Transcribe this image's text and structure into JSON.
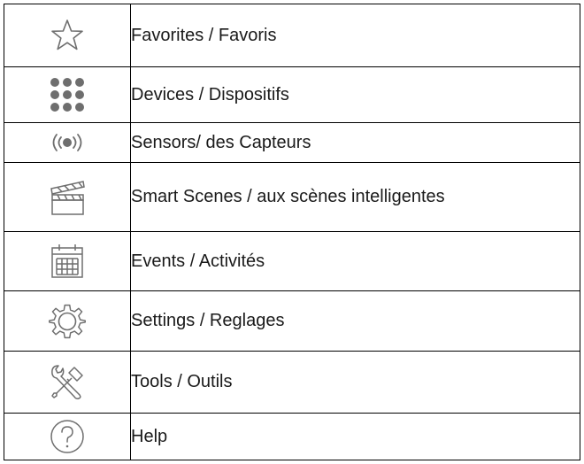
{
  "menu": {
    "items": [
      {
        "icon": "star-icon",
        "label": "Favorites / Favoris"
      },
      {
        "icon": "grid-dots-icon",
        "label": "Devices / Dispositifs"
      },
      {
        "icon": "sensor-broadcast-icon",
        "label": "Sensors/ des Capteurs"
      },
      {
        "icon": "clapperboard-icon",
        "label": "Smart Scenes / aux scènes intelligentes"
      },
      {
        "icon": "calendar-icon",
        "label": "Events / Activités"
      },
      {
        "icon": "gear-icon",
        "label": "Settings / Reglages"
      },
      {
        "icon": "tools-icon",
        "label": "Tools / Outils"
      },
      {
        "icon": "help-question-icon",
        "label": "Help"
      }
    ]
  },
  "colors": {
    "icon_stroke": "#6e6e6e",
    "border": "#000000",
    "text": "#1a1a1a"
  }
}
